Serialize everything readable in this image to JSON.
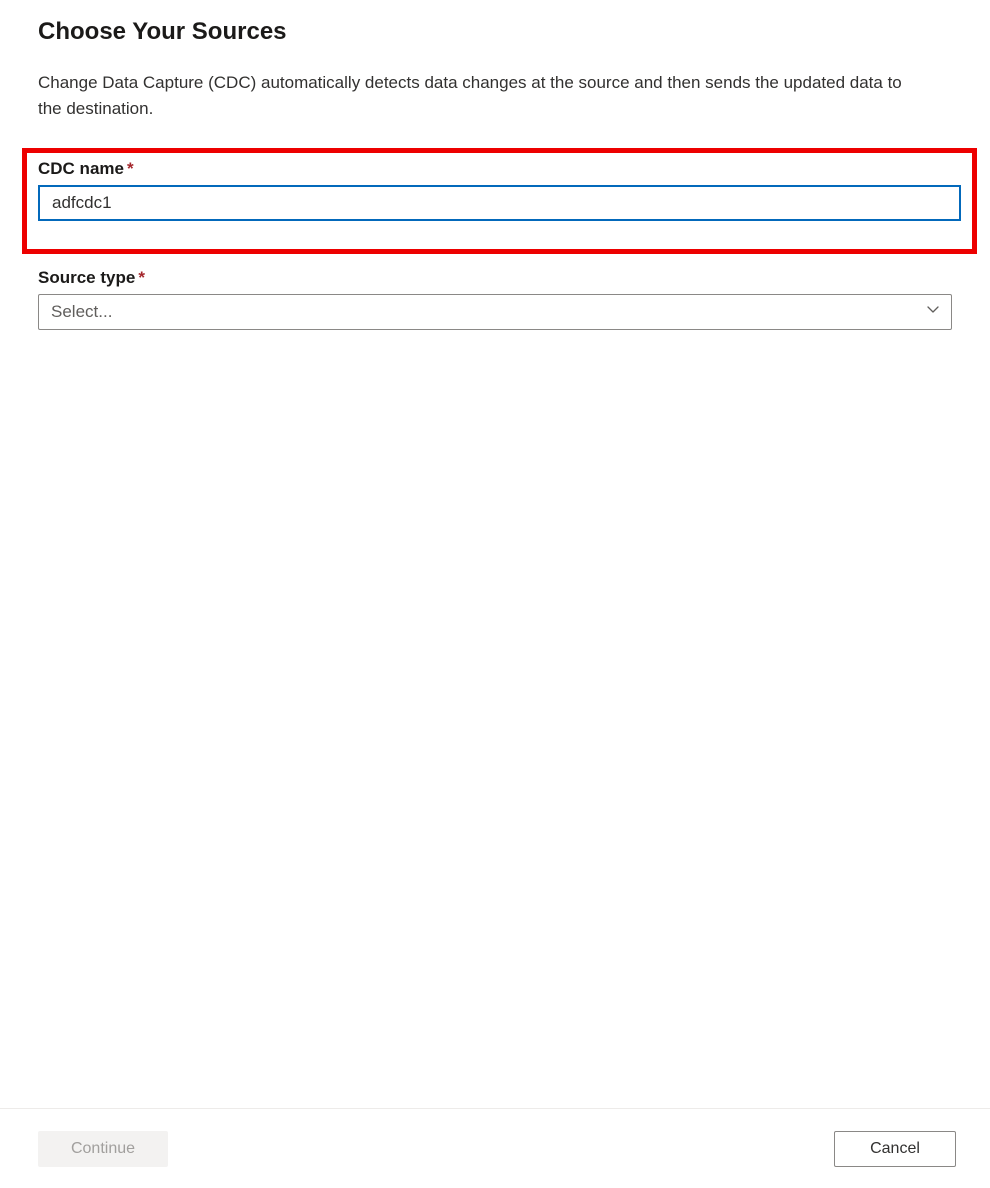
{
  "header": {
    "title": "Choose Your Sources",
    "description": "Change Data Capture (CDC) automatically detects data changes at the source and then sends the updated data to the destination."
  },
  "form": {
    "cdc_name": {
      "label": "CDC name",
      "required_marker": "*",
      "value": "adfcdc1"
    },
    "source_type": {
      "label": "Source type",
      "required_marker": "*",
      "placeholder": "Select..."
    }
  },
  "footer": {
    "continue_label": "Continue",
    "cancel_label": "Cancel"
  }
}
